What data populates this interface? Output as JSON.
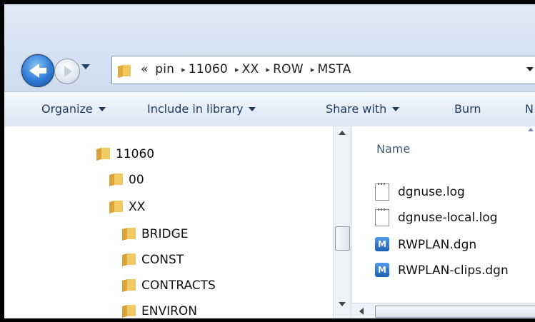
{
  "address": {
    "overflow_glyph": "«",
    "separator": "▸",
    "crumbs": [
      "pin",
      "11060",
      "XX",
      "ROW",
      "MSTA"
    ]
  },
  "commands": {
    "organize": "Organize",
    "include_in_library": "Include in library",
    "share_with": "Share with",
    "burn": "Burn",
    "new_truncated": "N"
  },
  "tree": [
    {
      "label": "11060"
    },
    {
      "label": "00"
    },
    {
      "label": "XX"
    },
    {
      "label": "BRIDGE"
    },
    {
      "label": "CONST"
    },
    {
      "label": "CONTRACTS"
    },
    {
      "label": "ENVIRON"
    }
  ],
  "files": {
    "column_name": "Name",
    "items": [
      {
        "name": "dgnuse.log",
        "icon": "text-document-icon"
      },
      {
        "name": "dgnuse-local.log",
        "icon": "text-document-icon"
      },
      {
        "name": "RWPLAN.dgn",
        "icon": "microstation-file-icon"
      },
      {
        "name": "RWPLAN-clips.dgn",
        "icon": "microstation-file-icon"
      }
    ]
  },
  "icons": {
    "dgn_glyph": "M"
  },
  "colors": {
    "folder": "#e8b84a",
    "command_text": "#1e3a5f",
    "dgn_icon": "#1b5fb4"
  }
}
